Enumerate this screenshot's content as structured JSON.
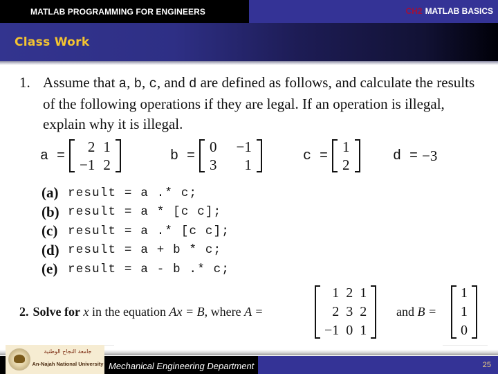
{
  "header": {
    "course_title": "MATLAB PROGRAMMING FOR ENGINEERS",
    "chapter_tag": "CH2",
    "chapter_title": "MATLAB BASICS",
    "slide_title": "Class Work"
  },
  "colors": {
    "header_black": "#000000",
    "header_blue": "#343396",
    "title_yellow": "#f4c430",
    "chapter_tag_red": "#a0103a",
    "page_number": "#f0d080"
  },
  "question1": {
    "number": "1.",
    "text_parts": [
      "Assume that ",
      "a",
      ", ",
      "b",
      ", ",
      "c",
      ", and ",
      "d",
      " are defined as follows, and calculate the results of the following operations if they are legal. If an operation is illegal, explain why it is illegal."
    ],
    "definitions": {
      "a": {
        "name": "a",
        "eq": "=",
        "rows": [
          [
            "2",
            "1"
          ],
          [
            "−1",
            "2"
          ]
        ]
      },
      "b": {
        "name": "b",
        "eq": "=",
        "rows": [
          [
            "0",
            "−1"
          ],
          [
            "3",
            "1"
          ]
        ]
      },
      "c": {
        "name": "c",
        "eq": "=",
        "rows": [
          [
            "1"
          ],
          [
            "2"
          ]
        ]
      },
      "d": {
        "name": "d",
        "eq": "=",
        "value": "−3"
      }
    },
    "operations": [
      {
        "label": "(a)",
        "code": "result = a .* c;"
      },
      {
        "label": "(b)",
        "code": "result = a * [c c];"
      },
      {
        "label": "(c)",
        "code": "result = a .* [c c];"
      },
      {
        "label": "(d)",
        "code": "result = a + b * c;"
      },
      {
        "label": "(e)",
        "code": "result = a - b .* c;"
      }
    ]
  },
  "question2": {
    "number": "2.",
    "lead": "Solve for",
    "var_x": "x",
    "mid_text": "in the equation",
    "equation": "Ax = B",
    "where": ", where",
    "A_label": "A =",
    "and_label": "and",
    "B_label": "B =",
    "A": [
      [
        "1",
        "2",
        "1"
      ],
      [
        "2",
        "3",
        "2"
      ],
      [
        "−1",
        "0",
        "1"
      ]
    ],
    "B": [
      [
        "1"
      ],
      [
        "1"
      ],
      [
        "0"
      ]
    ]
  },
  "footer": {
    "logo_arabic": "جامعة النجاح الوطنية",
    "logo_english": "An-Najah National University",
    "department": "Mechanical Engineering Department",
    "page_number": "25"
  }
}
